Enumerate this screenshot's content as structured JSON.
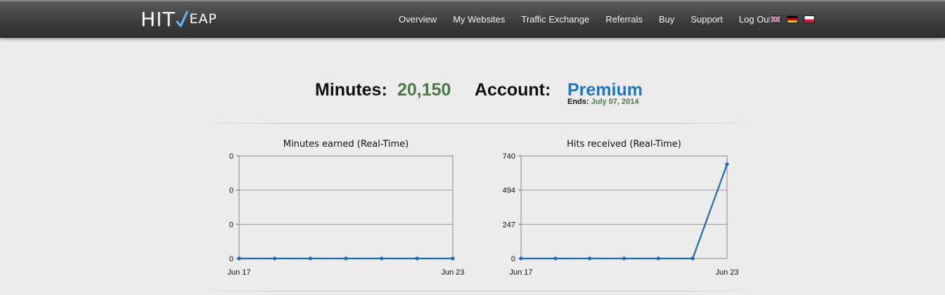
{
  "brand": {
    "part1": "HIT",
    "part2": "EAP"
  },
  "nav": {
    "items": [
      {
        "label": "Overview"
      },
      {
        "label": "My Websites"
      },
      {
        "label": "Traffic Exchange"
      },
      {
        "label": "Referrals"
      },
      {
        "label": "Buy"
      },
      {
        "label": "Support"
      },
      {
        "label": "Log Out"
      }
    ]
  },
  "languages": [
    "english-flag-icon",
    "german-flag-icon",
    "polish-flag-icon"
  ],
  "stats": {
    "minutes_label": "Minutes:",
    "minutes_value": "20,150",
    "account_label": "Account:",
    "account_value": "Premium",
    "ends_label": "Ends:",
    "ends_date": "July 07, 2014"
  },
  "colors": {
    "accent_green": "#4a7a45",
    "accent_blue": "#1a77c9",
    "line": "#1f6bb8"
  },
  "chart_data": [
    {
      "type": "line",
      "title": "Minutes earned (Real-Time)",
      "x": [
        "Jun 17",
        "Jun 18",
        "Jun 19",
        "Jun 20",
        "Jun 21",
        "Jun 22",
        "Jun 23"
      ],
      "x_tick_labels": [
        "Jun 17",
        "Jun 23"
      ],
      "values": [
        0,
        0,
        0,
        0,
        0,
        0,
        0
      ],
      "y_tick_labels": [
        "0",
        "0",
        "0",
        "0"
      ],
      "ylim": [
        0,
        0
      ],
      "grid": true
    },
    {
      "type": "line",
      "title": "Hits received (Real-Time)",
      "x": [
        "Jun 17",
        "Jun 18",
        "Jun 19",
        "Jun 20",
        "Jun 21",
        "Jun 22",
        "Jun 23"
      ],
      "x_tick_labels": [
        "Jun 17",
        "Jun 23"
      ],
      "values": [
        0,
        0,
        0,
        0,
        0,
        0,
        680
      ],
      "y_tick_labels": [
        "0",
        "247",
        "494",
        "740"
      ],
      "ylim": [
        0,
        740
      ],
      "grid": true
    }
  ]
}
